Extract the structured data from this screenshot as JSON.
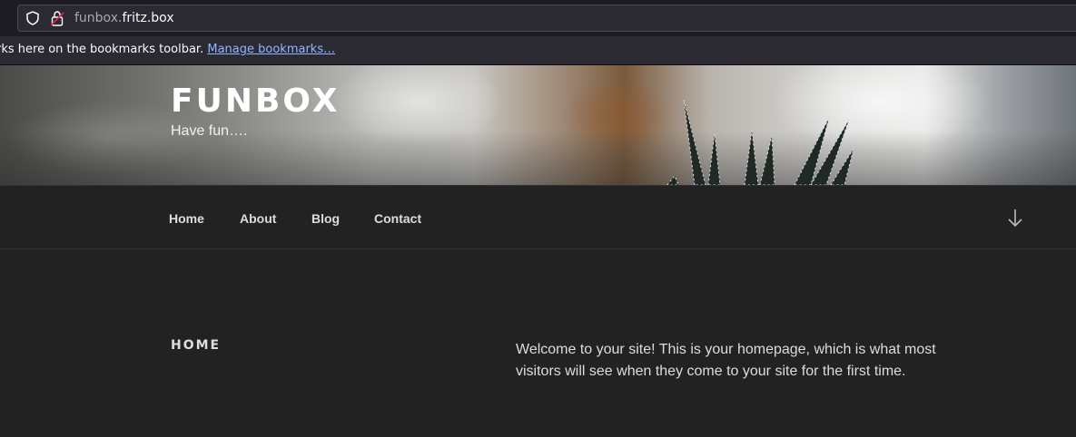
{
  "browser": {
    "url_subdomain": "funbox.",
    "url_domain": "fritz.box",
    "bookmarks_text": "rks here on the bookmarks toolbar.",
    "bookmarks_link": "Manage bookmarks…",
    "icons": [
      "shield-icon",
      "lock-icon"
    ]
  },
  "site": {
    "title": "FUNBOX",
    "tagline": "Have fun…."
  },
  "nav": {
    "items": [
      {
        "label": "Home"
      },
      {
        "label": "About"
      },
      {
        "label": "Blog"
      },
      {
        "label": "Contact"
      }
    ],
    "scroll_icon": "arrow-down-icon"
  },
  "content": {
    "section_title": "HOME",
    "welcome_text": "Welcome to your site! This is your homepage, which is what most visitors will see when they come to your site for the first time."
  }
}
